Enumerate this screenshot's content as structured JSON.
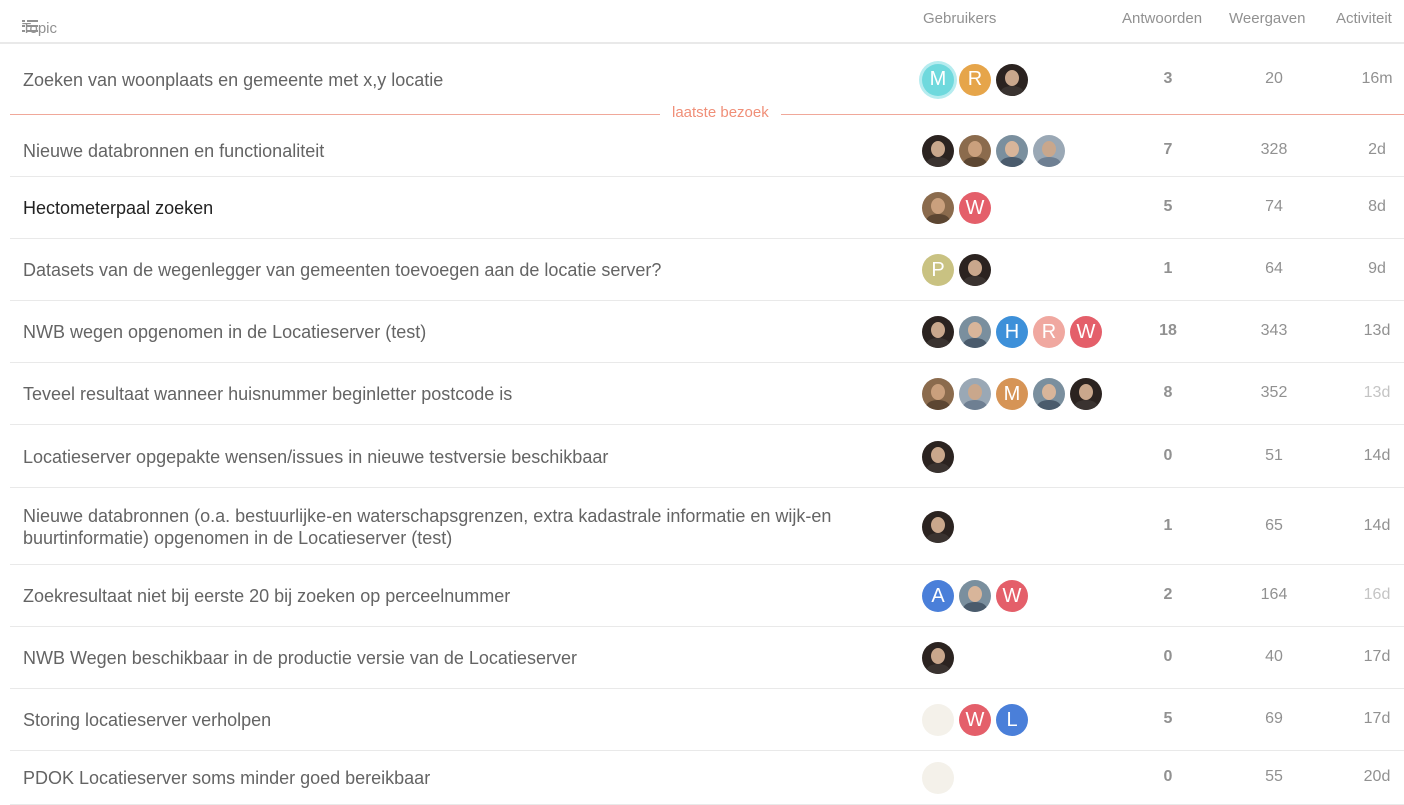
{
  "header": {
    "topic": "Topic",
    "users": "Gebruikers",
    "replies": "Antwoorden",
    "views": "Weergaven",
    "activity": "Activiteit"
  },
  "last_visit_label": "laatste bezoek",
  "colors": {
    "accent_last_visit": "#f08f78",
    "row_border": "#e9e9e9"
  },
  "topics": [
    {
      "title": "Zoeken van woonplaats en gemeente met x,y locatie",
      "replies": "3",
      "views": "20",
      "activity": "16m",
      "posters": [
        {
          "type": "letter",
          "letter": "M",
          "color": "#6fd9dd",
          "ring": true
        },
        {
          "type": "letter",
          "letter": "R",
          "color": "#e6a54a"
        },
        {
          "type": "photo"
        }
      ]
    },
    {
      "title": "Nieuwe databronnen en functionaliteit",
      "replies": "7",
      "views": "328",
      "activity": "2d",
      "posters": [
        {
          "type": "photo"
        },
        {
          "type": "photo",
          "variant": "p4"
        },
        {
          "type": "photo",
          "variant": "p2"
        },
        {
          "type": "photo",
          "variant": "p3"
        }
      ]
    },
    {
      "title": "Hectometerpaal zoeken",
      "unread": true,
      "replies": "5",
      "views": "74",
      "activity": "8d",
      "posters": [
        {
          "type": "photo",
          "variant": "p4"
        },
        {
          "type": "letter",
          "letter": "W",
          "color": "#e45f6a"
        }
      ]
    },
    {
      "title": "Datasets van de wegenlegger van gemeenten toevoegen aan de locatie server?",
      "replies": "1",
      "views": "64",
      "activity": "9d",
      "posters": [
        {
          "type": "letter",
          "letter": "P",
          "color": "#c9c282"
        },
        {
          "type": "photo"
        }
      ]
    },
    {
      "title": "NWB wegen opgenomen in de Locatieserver (test)",
      "replies": "18",
      "views": "343",
      "activity": "13d",
      "posters": [
        {
          "type": "photo"
        },
        {
          "type": "photo",
          "variant": "p2"
        },
        {
          "type": "letter",
          "letter": "H",
          "color": "#3d90d9"
        },
        {
          "type": "letter",
          "letter": "R",
          "color": "#f0a8a0"
        },
        {
          "type": "letter",
          "letter": "W",
          "color": "#e45f6a"
        }
      ]
    },
    {
      "title": "Teveel resultaat wanneer huisnummer beginletter postcode is",
      "replies": "8",
      "views": "352",
      "activity": "13d",
      "activity_faint": true,
      "posters": [
        {
          "type": "photo",
          "variant": "p4"
        },
        {
          "type": "photo",
          "variant": "p3"
        },
        {
          "type": "letter",
          "letter": "M",
          "color": "#d69456"
        },
        {
          "type": "photo",
          "variant": "p2"
        },
        {
          "type": "photo"
        }
      ]
    },
    {
      "title": "Locatieserver opgepakte wensen/issues in nieuwe testversie beschikbaar",
      "replies": "0",
      "views": "51",
      "activity": "14d",
      "posters": [
        {
          "type": "photo"
        }
      ]
    },
    {
      "title": "Nieuwe databronnen (o.a. bestuurlijke-en waterschapsgrenzen, extra kadastrale informatie en wijk-en buurtinformatie) opgenomen in de Locatieserver (test)",
      "replies": "1",
      "views": "65",
      "activity": "14d",
      "posters": [
        {
          "type": "photo"
        }
      ]
    },
    {
      "title": "Zoekresultaat niet bij eerste 20 bij zoeken op perceelnummer",
      "replies": "2",
      "views": "164",
      "activity": "16d",
      "activity_faint": true,
      "posters": [
        {
          "type": "letter",
          "letter": "A",
          "color": "#4a7fd9"
        },
        {
          "type": "photo",
          "variant": "p2"
        },
        {
          "type": "letter",
          "letter": "W",
          "color": "#e45f6a"
        }
      ]
    },
    {
      "title": "NWB Wegen beschikbaar in de productie versie van de Locatieserver",
      "replies": "0",
      "views": "40",
      "activity": "17d",
      "posters": [
        {
          "type": "photo"
        }
      ]
    },
    {
      "title": "Storing locatieserver verholpen",
      "replies": "5",
      "views": "69",
      "activity": "17d",
      "posters": [
        {
          "type": "logo"
        },
        {
          "type": "letter",
          "letter": "W",
          "color": "#e45f6a"
        },
        {
          "type": "letter",
          "letter": "L",
          "color": "#4a7fd9"
        }
      ]
    },
    {
      "title": "PDOK Locatieserver soms minder goed bereikbaar",
      "replies": "0",
      "views": "55",
      "activity": "20d",
      "posters": [
        {
          "type": "logo"
        }
      ]
    }
  ]
}
